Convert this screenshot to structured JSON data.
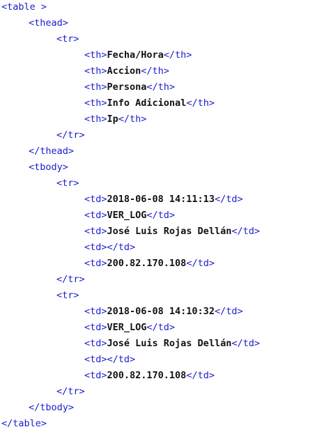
{
  "code": {
    "lines": [
      {
        "indent": 0,
        "tag": "<table >"
      },
      {
        "indent": 1,
        "tag": "<thead>"
      },
      {
        "indent": 2,
        "tag": "<tr>"
      },
      {
        "indent": 3,
        "open": "<th>",
        "text": "Fecha/Hora",
        "close": "</th>"
      },
      {
        "indent": 3,
        "open": "<th>",
        "text": "Accion",
        "close": "</th>"
      },
      {
        "indent": 3,
        "open": "<th>",
        "text": "Persona",
        "close": "</th>"
      },
      {
        "indent": 3,
        "open": "<th>",
        "text": "Info Adicional",
        "close": "</th>"
      },
      {
        "indent": 3,
        "open": "<th>",
        "text": "Ip",
        "close": "</th>"
      },
      {
        "indent": 2,
        "tag": "</tr>"
      },
      {
        "indent": 1,
        "tag": "</thead>"
      },
      {
        "indent": 1,
        "tag": "<tbody>"
      },
      {
        "indent": 2,
        "tag": "<tr>"
      },
      {
        "indent": 3,
        "open": "<td>",
        "text": "2018-06-08 14:11:13",
        "close": "</td>"
      },
      {
        "indent": 3,
        "open": "<td>",
        "text": "VER_LOG",
        "close": "</td>"
      },
      {
        "indent": 3,
        "open": "<td>",
        "text": "José Luis Rojas Dellán",
        "close": "</td>"
      },
      {
        "indent": 3,
        "open": "<td>",
        "text": "",
        "close": "</td>"
      },
      {
        "indent": 3,
        "open": "<td>",
        "text": "200.82.170.108",
        "close": "</td>"
      },
      {
        "indent": 2,
        "tag": "</tr>"
      },
      {
        "indent": 2,
        "tag": "<tr>"
      },
      {
        "indent": 3,
        "open": "<td>",
        "text": "2018-06-08 14:10:32",
        "close": "</td>"
      },
      {
        "indent": 3,
        "open": "<td>",
        "text": "VER_LOG",
        "close": "</td>"
      },
      {
        "indent": 3,
        "open": "<td>",
        "text": "José Luis Rojas Dellán",
        "close": "</td>"
      },
      {
        "indent": 3,
        "open": "<td>",
        "text": "",
        "close": "</td>"
      },
      {
        "indent": 3,
        "open": "<td>",
        "text": "200.82.170.108",
        "close": "</td>"
      },
      {
        "indent": 2,
        "tag": "</tr>"
      },
      {
        "indent": 1,
        "tag": "</tbody>"
      },
      {
        "indent": 0,
        "tag": "</table>"
      }
    ]
  }
}
